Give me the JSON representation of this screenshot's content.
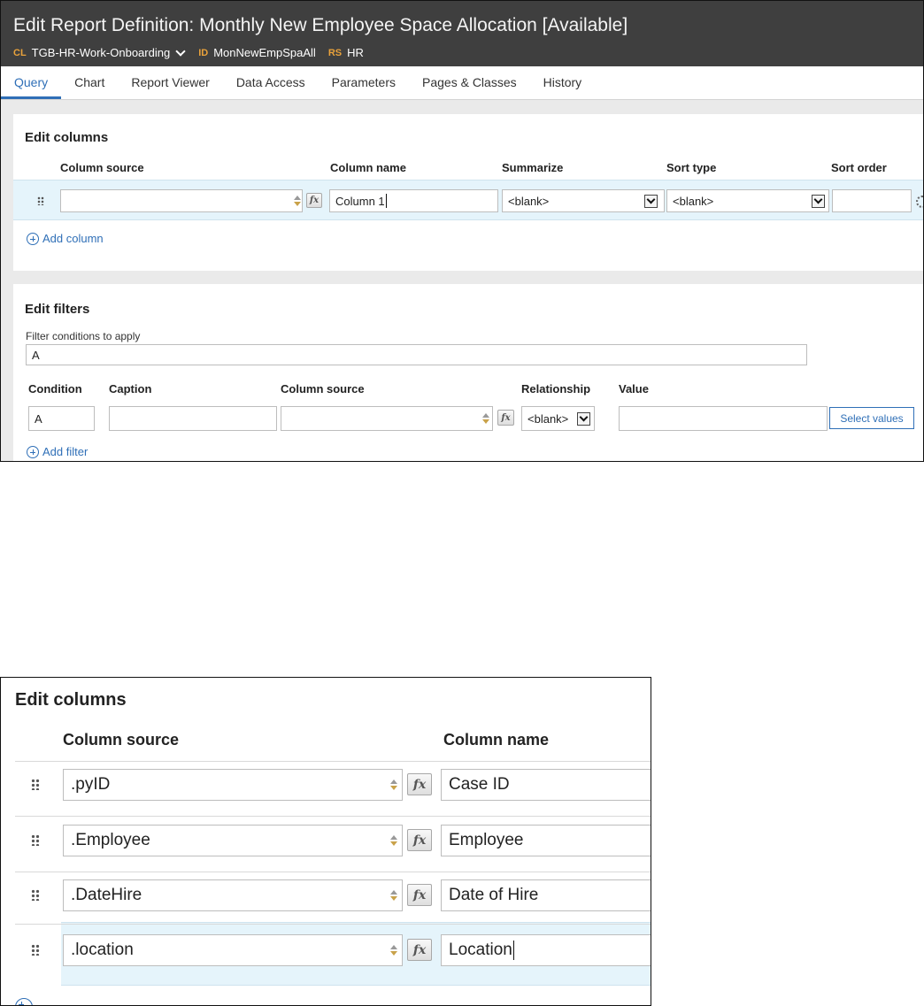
{
  "screenshot1": {
    "header": {
      "title": "Edit Report Definition: Monthly New Employee Space Allocation [Available]",
      "cl_tag": "CL",
      "cl_value": "TGB-HR-Work-Onboarding",
      "id_tag": "ID",
      "id_value": "MonNewEmpSpaAll",
      "rs_tag": "RS",
      "rs_value": "HR"
    },
    "tabs": [
      "Query",
      "Chart",
      "Report Viewer",
      "Data Access",
      "Parameters",
      "Pages & Classes",
      "History"
    ],
    "active_tab": "Query",
    "edit_columns": {
      "title": "Edit columns",
      "headers": {
        "column_source": "Column source",
        "column_name": "Column name",
        "summarize": "Summarize",
        "sort_type": "Sort type",
        "sort_order": "Sort order"
      },
      "row": {
        "column_source": "",
        "column_name": "Column 1",
        "summarize": "<blank>",
        "sort_type": "<blank>",
        "sort_order": ""
      },
      "add_label": "Add column"
    },
    "edit_filters": {
      "title": "Edit filters",
      "conditions_label": "Filter conditions to apply",
      "conditions_value": "A",
      "headers": {
        "condition": "Condition",
        "caption": "Caption",
        "column_source": "Column source",
        "relationship": "Relationship",
        "value": "Value"
      },
      "row": {
        "condition": "A",
        "caption": "",
        "column_source": "",
        "relationship": "<blank>",
        "value": ""
      },
      "select_values_label": "Select values",
      "add_label": "Add filter"
    }
  },
  "screenshot2": {
    "title": "Edit columns",
    "headers": {
      "column_source": "Column source",
      "column_name": "Column name"
    },
    "rows": [
      {
        "source": ".pyID",
        "name": "Case ID"
      },
      {
        "source": ".Employee",
        "name": "Employee"
      },
      {
        "source": ".DateHire",
        "name": "Date of Hire"
      },
      {
        "source": ".location",
        "name": "Location"
      }
    ]
  },
  "colors": {
    "header_bg": "#3f3f3f",
    "tag_orange": "#e9a23b",
    "accent_blue": "#2f6fb7",
    "row_highlight": "#e5f4fb"
  },
  "icons": [
    "drag-handle-icon",
    "spinner-arrows-icon",
    "fx-expression-icon",
    "dropdown-arrow-icon",
    "add-circle-icon",
    "gear-icon"
  ]
}
